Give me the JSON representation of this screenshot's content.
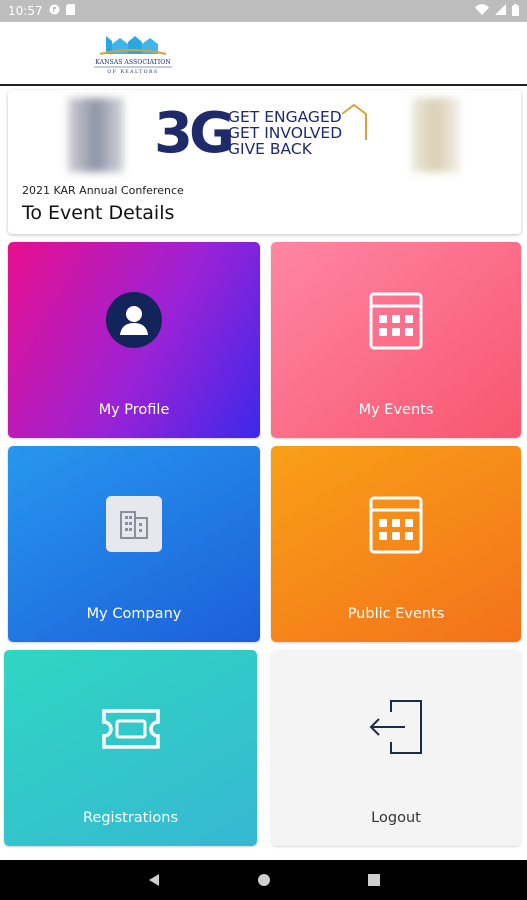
{
  "status_bar": {
    "time": "10:57"
  },
  "header": {
    "logo_text_top": "KANSAS ASSOCIATION",
    "logo_text_bottom": "OF REALTORS"
  },
  "banner": {
    "brand_mark": "3G",
    "tagline_1": "GET ENGAGED",
    "tagline_2": "GET INVOLVED",
    "tagline_3": "GIVE BACK",
    "conference_name": "2021 KAR Annual Conference",
    "event_link": "To Event Details"
  },
  "tiles": {
    "profile": "My Profile",
    "events": "My Events",
    "company": "My Company",
    "public_events": "Public Events",
    "registrations": "Registrations",
    "logout": "Logout"
  },
  "icons": {
    "profile": "user-avatar-icon",
    "events": "calendar-icon",
    "company": "building-icon",
    "public_events": "calendar-icon",
    "registrations": "ticket-icon",
    "logout": "logout-icon",
    "nav_back": "back-icon",
    "nav_home": "home-icon",
    "nav_recents": "recents-icon"
  },
  "colors": {
    "brand_navy": "#1f2a6b",
    "brand_gold": "#d8a33a",
    "tile_profile": "#9c22d6",
    "tile_events": "#f8566f",
    "tile_company": "#1c5fd9",
    "tile_public": "#f4721a",
    "tile_registrations": "#36b8d3",
    "tile_logout": "#f4f4f5"
  }
}
